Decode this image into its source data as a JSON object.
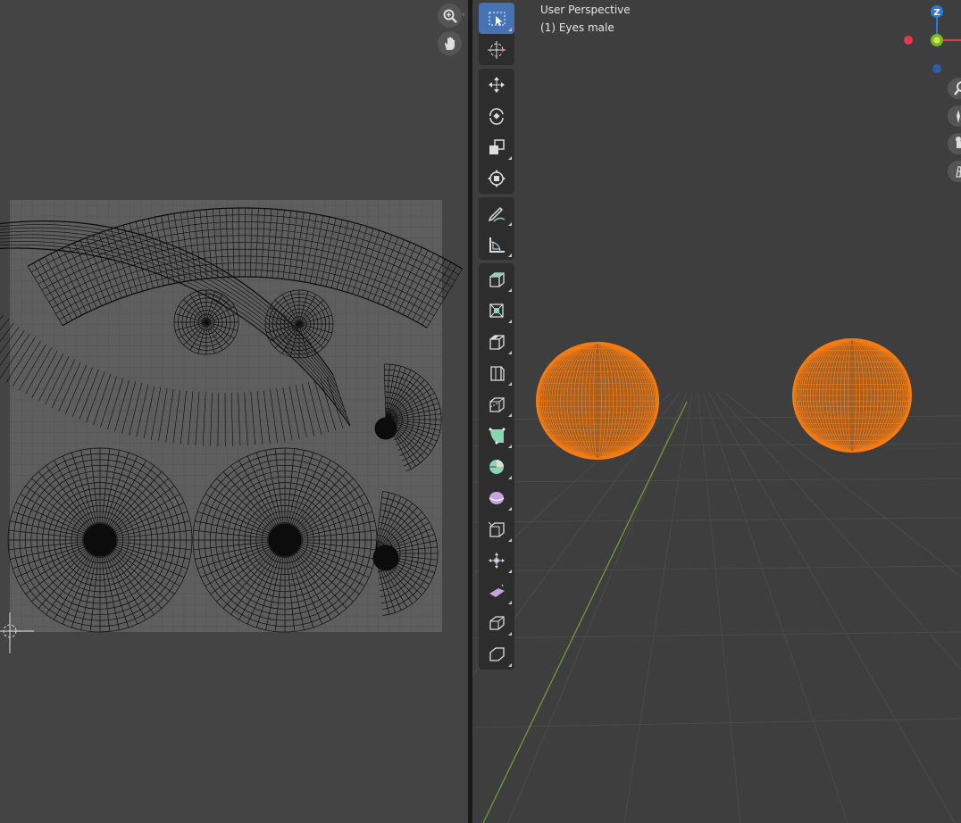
{
  "viewport": {
    "view_name": "User Perspective",
    "object_info": "(1) Eyes male"
  },
  "gizmo": {
    "z_axis_label": "Z",
    "colors": {
      "x": "#e4394f",
      "y": "#7bb728",
      "z": "#2e79d4"
    }
  },
  "toolbar": {
    "groups": [
      [
        "select-box-icon",
        "cursor-icon"
      ],
      [
        "move-icon",
        "rotate-icon",
        "scale-icon",
        "transform-icon"
      ],
      [
        "annotate-icon",
        "measure-icon"
      ],
      [
        "add-cube-icon",
        "extrude-region-icon",
        "inset-faces-icon",
        "bevel-icon",
        "loop-cut-icon",
        "knife-icon",
        "poly-build-icon",
        "spin-icon",
        "smooth-icon",
        "edge-slide-icon",
        "shrink-fatten-icon",
        "shear-icon",
        "rip-region-icon"
      ]
    ],
    "active_tool": "select-box-icon"
  },
  "uv_editor": {
    "nav_icons": [
      "zoom-icon",
      "pan-hand-icon"
    ]
  },
  "colors": {
    "selection_orange": "#f57c13",
    "uv_grid_bg": "#5d5d5d",
    "y_axis_line": "#6f9a3a"
  }
}
